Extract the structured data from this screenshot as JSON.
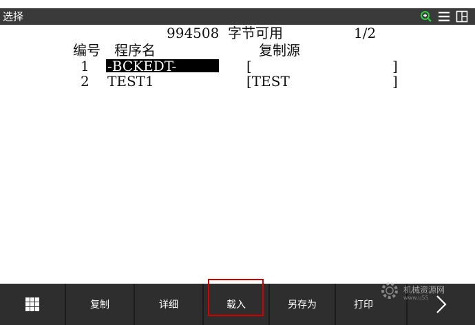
{
  "titlebar": {
    "title": "选择",
    "icons": [
      "zoom-in-icon",
      "menu-icon",
      "window-icon"
    ],
    "icon_accent": "#2ecc40"
  },
  "program_list": {
    "bytes_free": "994508",
    "bytes_label": "字节可用",
    "page": "1/2",
    "headers": {
      "number": "编号",
      "name": "程序名",
      "copy_source": "复制源"
    },
    "rows": [
      {
        "number": "1",
        "name": "-BCKEDT-",
        "copy_source": "[",
        "close": "]",
        "selected": true
      },
      {
        "number": "2",
        "name": "TEST1",
        "copy_source": "[TEST",
        "close": "]",
        "selected": false
      }
    ]
  },
  "softkeys": {
    "grid_icon": "grid-icon",
    "copy": "复制",
    "detail": "详细",
    "load": "载入",
    "save_as": "另存为",
    "print": "打印",
    "next_icon": "chevron-right-icon",
    "highlight_color": "#d40000"
  },
  "watermark": {
    "text": "机械资源网",
    "sub": "www.u55"
  }
}
